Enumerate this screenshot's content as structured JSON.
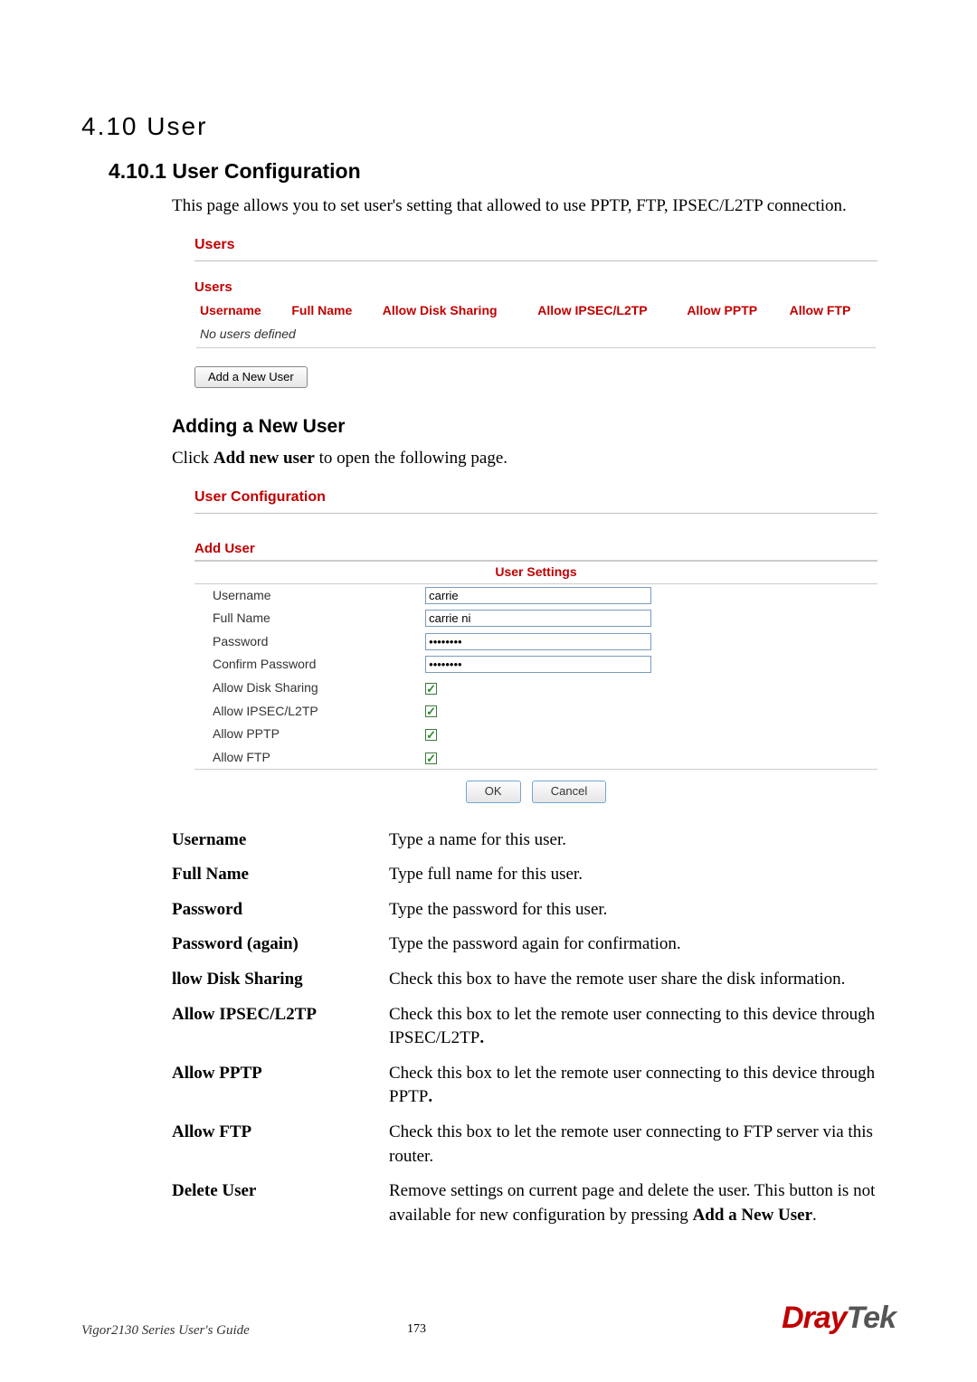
{
  "section_number_title": "4.10 User",
  "subsection_title": "4.10.1 User Configuration",
  "intro_text": "This page allows you to set user's setting that allowed to use PPTP, FTP, IPSEC/L2TP connection.",
  "users_panel": {
    "title": "Users",
    "subtitle": "Users",
    "columns": [
      "Username",
      "Full Name",
      "Allow Disk Sharing",
      "Allow IPSEC/L2TP",
      "Allow PPTP",
      "Allow FTP"
    ],
    "empty_text": "No users defined",
    "add_button": "Add a New User"
  },
  "adding_heading": "Adding a New User",
  "adding_text_prefix": "Click ",
  "adding_text_bold": "Add new user",
  "adding_text_suffix": " to open the following page.",
  "userconf_panel": {
    "title": "User Configuration",
    "box_title": "Add User",
    "settings_header": "User Settings",
    "rows": {
      "username_label": "Username",
      "username_value": "carrie",
      "fullname_label": "Full Name",
      "fullname_value": "carrie ni",
      "password_label": "Password",
      "password_value": "••••••••",
      "confirm_label": "Confirm Password",
      "confirm_value": "••••••••",
      "disk_label": "Allow Disk Sharing",
      "ipsec_label": "Allow IPSEC/L2TP",
      "pptp_label": "Allow PPTP",
      "ftp_label": "Allow FTP"
    },
    "ok_button": "OK",
    "cancel_button": "Cancel"
  },
  "definitions": [
    {
      "term": "Username",
      "desc": "Type a name for this user."
    },
    {
      "term": "Full Name",
      "desc": "Type full name for this user."
    },
    {
      "term": "Password",
      "desc": "Type the password for this user."
    },
    {
      "term": "Password (again)",
      "desc": "Type the password again for confirmation."
    },
    {
      "term": "llow Disk Sharing",
      "desc": "Check this box to have the remote user share the disk information."
    },
    {
      "term": "Allow IPSEC/L2TP",
      "desc_pre": "Check this box to let the remote user connecting to this device through IPSEC/L2TP",
      "desc_bold": "."
    },
    {
      "term": "Allow PPTP",
      "desc_pre": "Check this box to let the remote user connecting to this device through PPTP",
      "desc_bold": "."
    },
    {
      "term": "Allow FTP",
      "desc": "Check this box to let the remote user connecting to FTP server via this router."
    },
    {
      "term": "Delete User",
      "desc_pre": "Remove settings on current page and delete the user. This button is not available for new configuration by pressing ",
      "desc_bold": "Add a New User",
      "desc_post": "."
    }
  ],
  "footer": {
    "left": "Vigor2130 Series User's Guide",
    "page": "173",
    "brand_a": "Dray",
    "brand_b": "Tek"
  }
}
